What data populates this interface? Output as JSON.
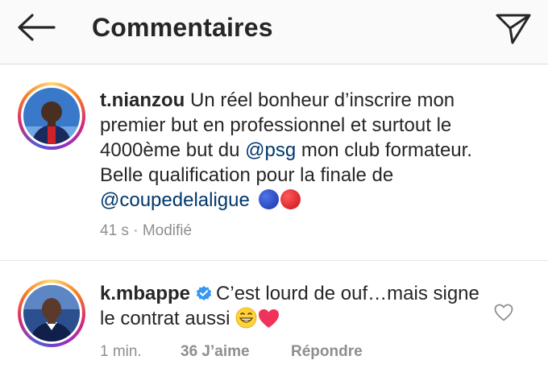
{
  "header": {
    "title": "Commentaires"
  },
  "caption": {
    "username": "t.nianzou",
    "text_1": " Un réel bonheur d’inscrire mon premier but en professionnel et surtout le 4000ème but du ",
    "mention_1": "@psg",
    "text_2": " mon club formateur. Belle qualification pour la finale de ",
    "mention_2": "@coupedelaligue",
    "emoji_colors": [
      "#1f3fbf",
      "#e8151b"
    ],
    "time": "41 s",
    "separator": " · ",
    "edited": "Modifié"
  },
  "comment": {
    "username": "k.mbappe",
    "verified_color": "#3897f0",
    "text": "C’est lourd de ouf…mais signe le contrat aussi ",
    "emojis": [
      "grin-emoji",
      "heart-emoji"
    ],
    "time": "1 min.",
    "likes": "36 J’aime",
    "reply": "Répondre"
  },
  "icons": {
    "back": "arrow-left-icon",
    "send": "paper-plane-icon",
    "like": "heart-outline-icon"
  }
}
